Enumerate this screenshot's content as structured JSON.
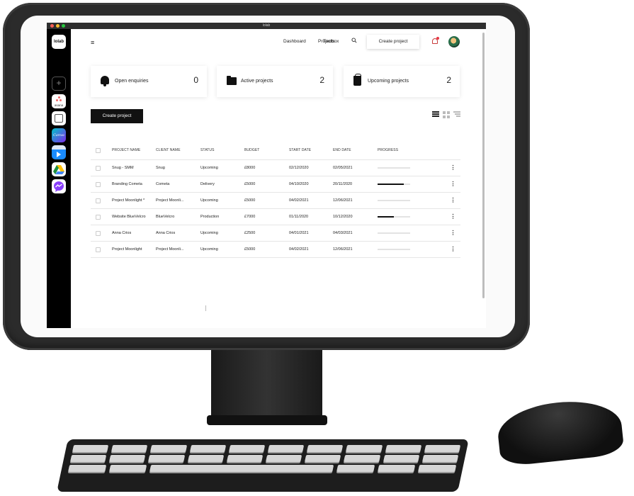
{
  "window": {
    "title": "lolab"
  },
  "dock": {
    "logo": "lolab",
    "add": "+",
    "apps": [
      {
        "name": "asana",
        "label": "asana"
      },
      {
        "name": "notes",
        "label": ""
      },
      {
        "name": "canva",
        "label": "Canva"
      },
      {
        "name": "keynote",
        "label": ""
      },
      {
        "name": "google-drive",
        "label": ""
      },
      {
        "name": "messenger",
        "label": ""
      }
    ]
  },
  "nav": {
    "menu_icon": "≡",
    "links": [
      "Dashboard",
      "Projects",
      "Toolbox"
    ],
    "search_icon": "search-icon",
    "create_button": "Create project",
    "notification_icon": "bell-icon"
  },
  "summary": [
    {
      "label": "Open enquiries",
      "value": "0",
      "icon": "bell-icon"
    },
    {
      "label": "Active projects",
      "value": "2",
      "icon": "folder-icon"
    },
    {
      "label": "Upcoming projects",
      "value": "2",
      "icon": "bag-icon"
    }
  ],
  "toolbar": {
    "create_button": "Create project"
  },
  "table": {
    "headers": [
      "PROJECT NAME",
      "CLIENT NAME",
      "STATUS",
      "BUDGET",
      "START DATE",
      "END DATE",
      "PROGRESS"
    ],
    "rows": [
      {
        "name": "Snug - SMM",
        "client": "Snug",
        "status": "Upcoming",
        "budget": "£8000",
        "start": "02/12/2020",
        "end": "02/05/2021",
        "progress": 0
      },
      {
        "name": "Branding Cometa",
        "client": "Cometa",
        "status": "Delivery",
        "budget": "£5000",
        "start": "04/10/2020",
        "end": "20/11/2020",
        "progress": 0.8
      },
      {
        "name": "Project Moonlight *",
        "client": "Project Moonli...",
        "status": "Upcoming",
        "budget": "£5000",
        "start": "04/02/2021",
        "end": "12/06/2021",
        "progress": 0
      },
      {
        "name": "Website BlueVelcro",
        "client": "BlueVelcro",
        "status": "Production",
        "budget": "£7000",
        "start": "01/11/2020",
        "end": "10/12/2020",
        "progress": 0.5
      },
      {
        "name": "Anna Crios",
        "client": "Anna Crios",
        "status": "Upcoming",
        "budget": "£2500",
        "start": "04/01/2021",
        "end": "04/03/2021",
        "progress": 0
      },
      {
        "name": "Project Moonlight",
        "client": "Project Moonli...",
        "status": "Upcoming",
        "budget": "£5000",
        "start": "04/02/2021",
        "end": "12/06/2021",
        "progress": 0
      }
    ]
  },
  "colors": {
    "accent": "#111111",
    "notification": "#e63946",
    "bezel": "#2b2b2b"
  }
}
